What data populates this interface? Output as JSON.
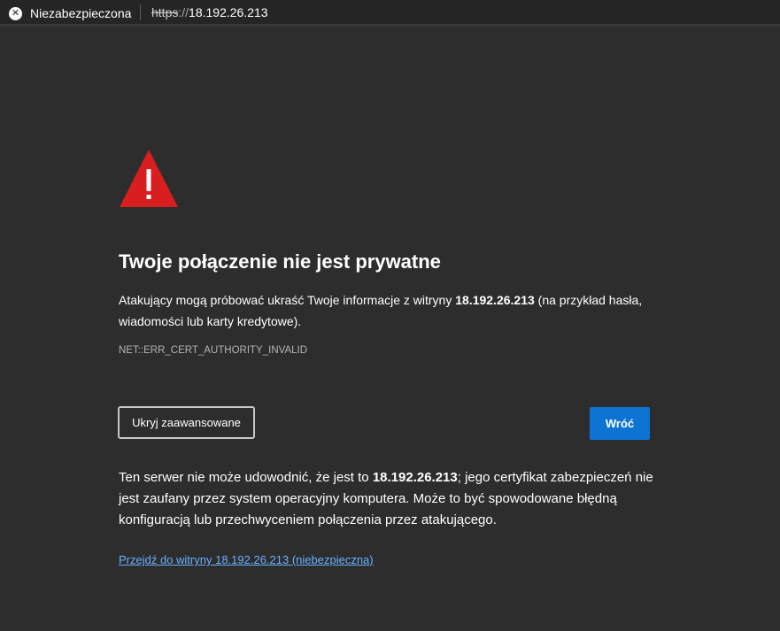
{
  "address_bar": {
    "security_label": "Niezabezpieczona",
    "security_icon": "close-circle-icon",
    "url_scheme": "https",
    "url_separator": "://",
    "url_host": "18.192.26.213"
  },
  "page": {
    "warning_icon": "warning-triangle-icon",
    "warning_color": "#d81e1e",
    "heading": "Twoje połączenie nie jest prywatne",
    "description": {
      "before": "Atakujący mogą próbować ukraść Twoje informacje z witryny ",
      "host": "18.192.26.213",
      "after": " (na przykład hasła, wiadomości lub karty kredytowe)."
    },
    "error_code": "NET::ERR_CERT_AUTHORITY_INVALID",
    "hide_advanced_button": "Ukryj zaawansowane",
    "back_button": "Wróć",
    "back_button_color": "#0e74d3",
    "details": {
      "before": "Ten serwer nie może udowodnić, że jest to ",
      "host": "18.192.26.213",
      "after": "; jego certyfikat zabezpieczeń nie jest zaufany przez system operacyjny komputera. Może to być spowodowane błędną konfiguracją lub przechwyceniem połączenia przez atakującego."
    },
    "proceed_link": "Przejdź do witryny 18.192.26.213 (niebezpieczna)",
    "link_color": "#6ab0ff"
  }
}
